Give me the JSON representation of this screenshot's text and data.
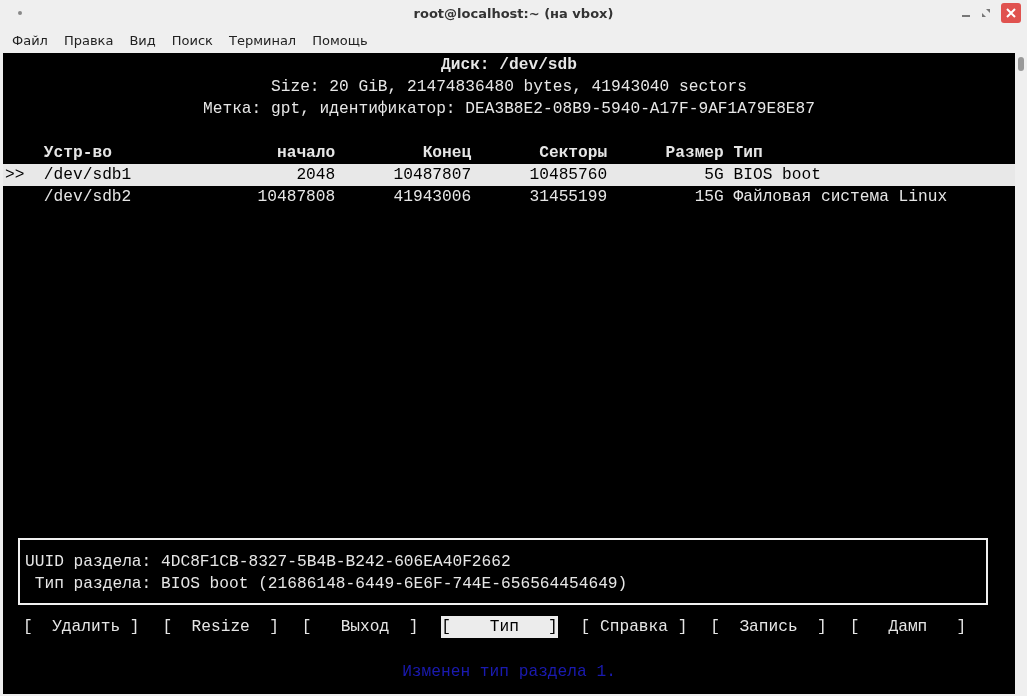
{
  "window": {
    "title": "root@localhost:~ (на vbox)"
  },
  "menu": [
    "Файл",
    "Правка",
    "Вид",
    "Поиск",
    "Терминал",
    "Помощь"
  ],
  "header": {
    "title": "Диск: /dev/sdb",
    "size": "Size: 20 GiB, 21474836480 bytes, 41943040 sectors",
    "label": "Метка: gpt, идентификатор: DEA3B8E2-08B9-5940-A17F-9AF1A79E8E87"
  },
  "table": {
    "columns": [
      "Устр-во",
      "начало",
      "Конец",
      "Секторы",
      "Размер",
      "Тип"
    ],
    "rows": [
      {
        "marker": ">>",
        "cells": [
          "/dev/sdb1",
          "2048",
          "10487807",
          "10485760",
          "5G",
          "BIOS boot"
        ],
        "selected": true
      },
      {
        "cells": [
          "/dev/sdb2",
          "10487808",
          "41943006",
          "31455199",
          "15G",
          "Файловая система Linux"
        ],
        "selected": false
      }
    ]
  },
  "info": [
    "UUID раздела: 4DC8F1CB-8327-5B4B-B242-606EA40F2662",
    " Тип раздела: BIOS boot (21686148-6449-6E6F-744E-656564454649)"
  ],
  "actions": [
    {
      "label": "[  Удалить ]",
      "selected": false
    },
    {
      "label": "[  Resize  ]",
      "selected": false
    },
    {
      "label": "[   Выход  ]",
      "selected": false
    },
    {
      "label": "[    Тип   ]",
      "selected": true
    },
    {
      "label": "[ Справка ]",
      "selected": false
    },
    {
      "label": "[  Запись  ]",
      "selected": false
    },
    {
      "label": "[   Дамп   ]",
      "selected": false
    }
  ],
  "status": "Изменен тип раздела 1."
}
